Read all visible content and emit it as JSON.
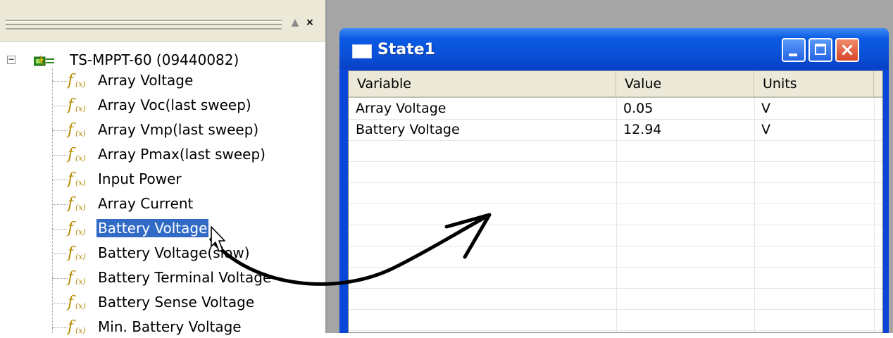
{
  "tree_pane": {
    "root_label": "TS-MPPT-60 (09440082)",
    "expander": "−",
    "items": [
      {
        "label": "Array Voltage"
      },
      {
        "label": "Array Voc(last sweep)"
      },
      {
        "label": "Array Vmp(last sweep)"
      },
      {
        "label": "Array Pmax(last sweep)"
      },
      {
        "label": "Input Power"
      },
      {
        "label": "Array Current"
      },
      {
        "label": "Battery Voltage",
        "selected": true
      },
      {
        "label": "Battery Voltage(slow)"
      },
      {
        "label": "Battery Terminal Voltage"
      },
      {
        "label": "Battery Sense Voltage"
      },
      {
        "label": "Min. Battery Voltage"
      }
    ],
    "item_icon": "function-fx-icon",
    "header_buttons": {
      "maximize": "▲",
      "close": "×"
    }
  },
  "window": {
    "title": "State1",
    "columns": {
      "variable": "Variable",
      "value": "Value",
      "units": "Units"
    },
    "rows": [
      {
        "variable": "Array Voltage",
        "value": "0.05",
        "units": "V"
      },
      {
        "variable": "Battery Voltage",
        "value": "12.94",
        "units": "V"
      }
    ],
    "close_glyph": "×"
  },
  "colors": {
    "selection": "#316ac5",
    "title_bar": "#0a4fd6",
    "mdi_background": "#a5a5a5",
    "close_button": "#d6452a",
    "fx_icon": "#b58a00"
  }
}
